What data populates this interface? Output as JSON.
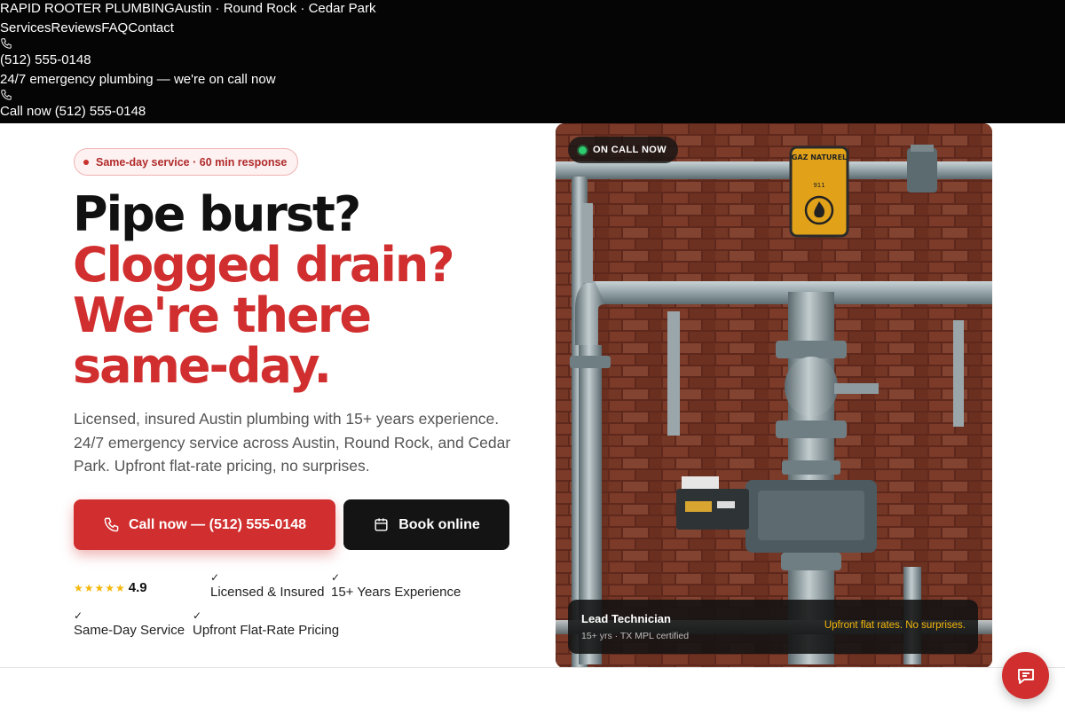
{
  "topnav": {
    "brand": "RAPID ROOTER PLUMBING",
    "service_area": "Austin · Round Rock · Cedar Park",
    "links": [
      "Services",
      "Reviews",
      "FAQ",
      "Contact"
    ],
    "phone": "(512) 555-0148",
    "emergency_text": "24/7 emergency plumbing — we're on call now",
    "call_now": "Call now (512) 555-0148"
  },
  "hero": {
    "badge": "Same-day service · 60 min response",
    "headline_line1": "Pipe burst?",
    "headline_line2": "Clogged drain?",
    "headline_line3": "We're there",
    "headline_line4": "same-day.",
    "subtext": "Licensed, insured Austin plumbing with 15+ years experience. 24/7 emergency service across Austin, Round Rock, and Cedar Park. Upfront flat-rate pricing, no surprises.",
    "primary_cta": "Call now — (512) 555-0148",
    "secondary_cta": "Book online",
    "rating": "4.9",
    "rating_stars": "★★★★★",
    "check_glyph": "✓",
    "trust_items": [
      "Licensed & Insured",
      "15+ Years Experience",
      "Same-Day Service",
      "Upfront Flat-Rate Pricing"
    ]
  },
  "photo": {
    "status_pill": "ON CALL NOW",
    "sign_text": "GAZ NATUREL",
    "sign_number": "911",
    "tech_title": "Lead Technician",
    "tech_meta": "15+ yrs · TX MPL certified",
    "tech_promise": "Upfront flat rates. No surprises."
  },
  "colors": {
    "accent_red": "#d12f2f",
    "star_gold": "#f5b70a",
    "dark": "#141414",
    "online_green": "#2ecc71"
  },
  "icons": {
    "call_button": "phone-icon",
    "book_button": "calendar-icon",
    "chat_fab": "chat-bubble-icon"
  }
}
